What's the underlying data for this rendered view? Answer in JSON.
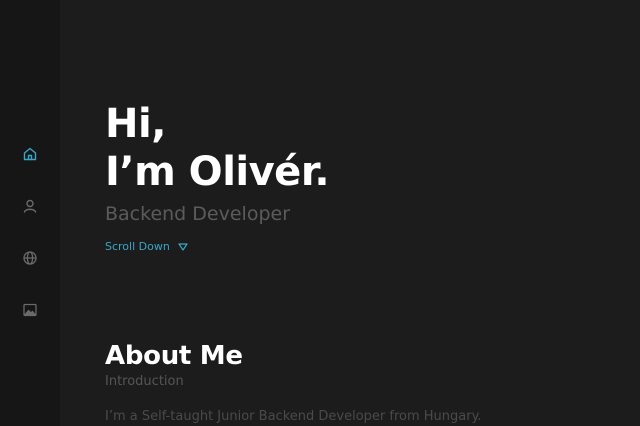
{
  "sidebar": {
    "items": [
      {
        "name": "home",
        "icon": "home-icon",
        "active": true,
        "color": "#39a6c6"
      },
      {
        "name": "about",
        "icon": "user-icon",
        "active": false,
        "color": "#6a6a6a"
      },
      {
        "name": "skills",
        "icon": "globe-icon",
        "active": false,
        "color": "#6a6a6a"
      },
      {
        "name": "gallery",
        "icon": "image-icon",
        "active": false,
        "color": "#6a6a6a"
      }
    ]
  },
  "hero": {
    "greeting_line1": "Hi,",
    "greeting_line2": "I’m Olivér.",
    "subtitle": "Backend Developer",
    "scroll_label": "Scroll Down"
  },
  "about": {
    "title": "About Me",
    "subtitle": "Introduction",
    "text": "I’m a Self-taught Junior Backend Developer from Hungary."
  },
  "colors": {
    "accent": "#39a6c6",
    "background": "#1c1c1c",
    "sidebar": "#161616"
  }
}
